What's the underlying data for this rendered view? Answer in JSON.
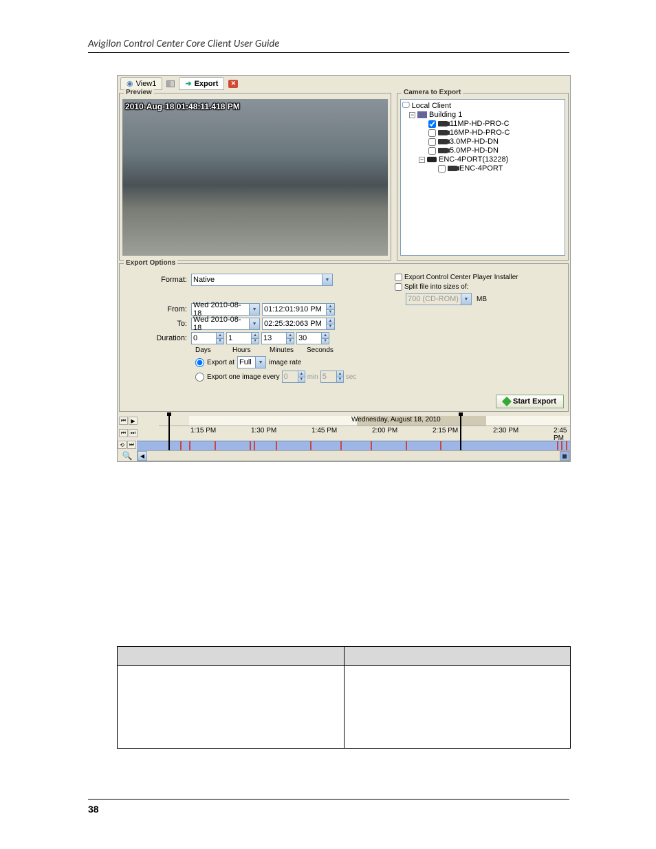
{
  "doc": {
    "header": "Avigilon Control Center Core Client User Guide",
    "page_number": "38"
  },
  "app": {
    "tabs": {
      "view": "View1",
      "export": "Export"
    },
    "sections": {
      "preview": "Preview",
      "camera_to_export": "Camera to Export",
      "export_options": "Export Options"
    },
    "video_timestamp": "2010-Aug-18 01:48:11.418 PM",
    "tree": {
      "root": "Local Client",
      "server": "Building 1",
      "cameras": [
        {
          "name": "11MP-HD-PRO-C",
          "checked": true
        },
        {
          "name": "16MP-HD-PRO-C",
          "checked": false
        },
        {
          "name": "3.0MP-HD-DN",
          "checked": false
        },
        {
          "name": "5.0MP-HD-DN",
          "checked": false
        }
      ],
      "encoder": "ENC-4PORT(13228)",
      "encoder_child": "ENC-4PORT"
    },
    "options": {
      "format_label": "Format:",
      "format_value": "Native",
      "from_label": "From:",
      "from_date": "Wed 2010-08-18",
      "from_time": "01:12:01:910 PM",
      "to_label": "To:",
      "to_date": "Wed 2010-08-18",
      "to_time": "02:25:32:063 PM",
      "duration_label": "Duration:",
      "days": "0",
      "days_label": "Days",
      "hours": "1",
      "hours_label": "Hours",
      "minutes": "13",
      "minutes_label": "Minutes",
      "seconds": "30",
      "seconds_label": "Seconds",
      "export_at_label": "Export at",
      "export_at_value": "Full",
      "image_rate": "image rate",
      "export_one_label": "Export one image every",
      "export_one_min": "0",
      "export_one_min_label": "min",
      "export_one_sec": "5",
      "export_one_sec_label": "sec",
      "player_installer": "Export Control Center Player Installer",
      "split_label": "Split file into sizes of:",
      "split_value": "700 (CD-ROM)",
      "split_unit": "MB",
      "start_export": "Start Export"
    },
    "timeline": {
      "date_header": "Wednesday, August 18, 2010",
      "ticks": [
        "1:15 PM",
        "1:30 PM",
        "1:45 PM",
        "2:00 PM",
        "2:15 PM",
        "2:30 PM",
        "2:45 PM"
      ]
    }
  }
}
